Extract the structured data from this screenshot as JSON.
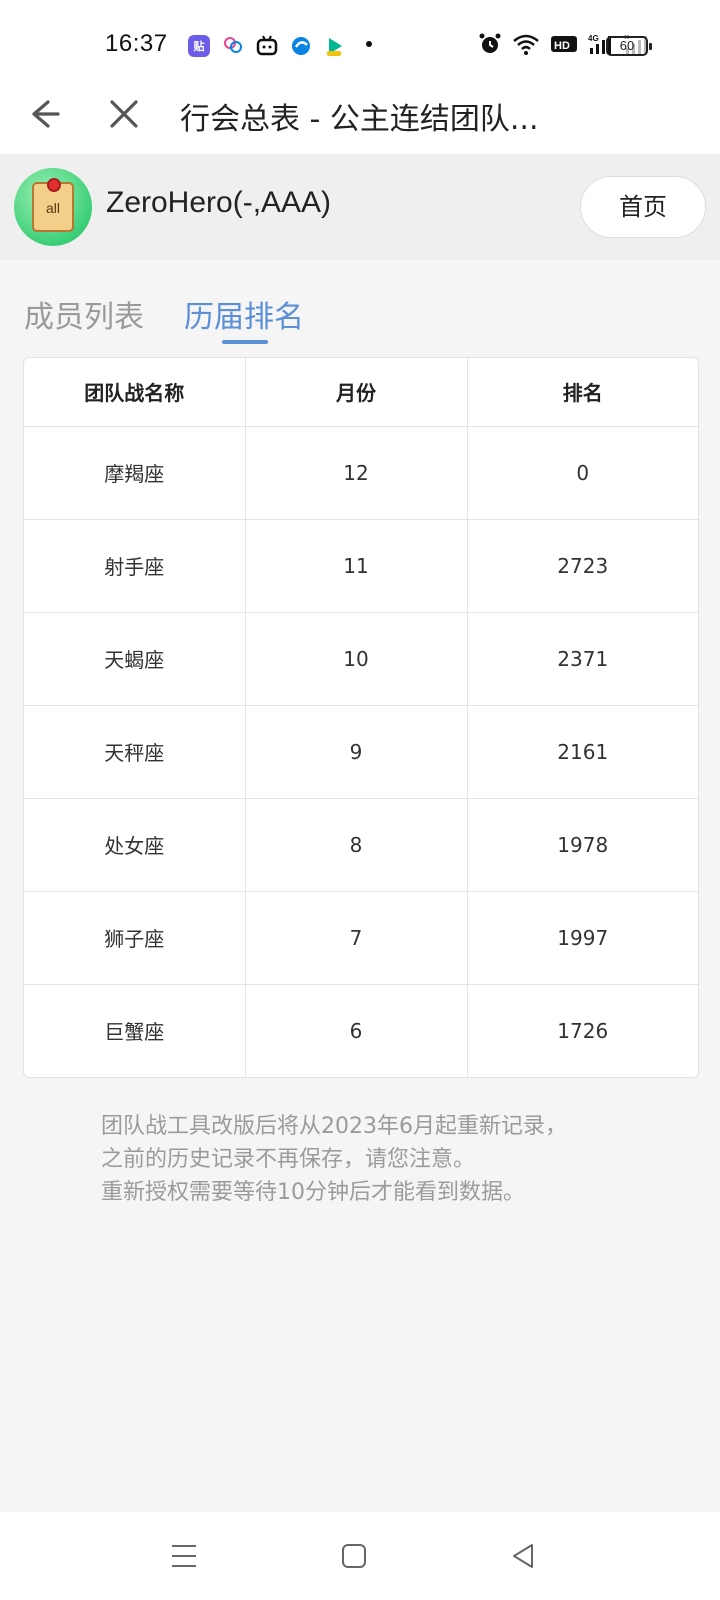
{
  "status_bar": {
    "time": "16:37",
    "app_icons": [
      {
        "name": "tieba-icon",
        "label": "贴",
        "color": "#6c5ce7"
      },
      {
        "name": "lines-icon",
        "label": "",
        "color": "#e84393"
      },
      {
        "name": "bilibili-icon",
        "label": "",
        "color": "#111111"
      },
      {
        "name": "browser-icon",
        "label": "",
        "color": "#0984e3"
      },
      {
        "name": "video-icon",
        "label": "",
        "color": "#00b894"
      }
    ],
    "battery": "60"
  },
  "nav": {
    "title": "行会总表 - 公主连结团队..."
  },
  "guild": {
    "avatar_text": "all",
    "name": "ZeroHero(-,AAA)",
    "home_label": "首页"
  },
  "tabs": [
    {
      "label": "成员列表",
      "active": false
    },
    {
      "label": "历届排名",
      "active": true
    }
  ],
  "table": {
    "headers": [
      "团队战名称",
      "月份",
      "排名"
    ],
    "rows": [
      {
        "name": "摩羯座",
        "month": "12",
        "rank": "0"
      },
      {
        "name": "射手座",
        "month": "11",
        "rank": "2723"
      },
      {
        "name": "天蝎座",
        "month": "10",
        "rank": "2371"
      },
      {
        "name": "天秤座",
        "month": "9",
        "rank": "2161"
      },
      {
        "name": "处女座",
        "month": "8",
        "rank": "1978"
      },
      {
        "name": "狮子座",
        "month": "7",
        "rank": "1997"
      },
      {
        "name": "巨蟹座",
        "month": "6",
        "rank": "1726"
      }
    ]
  },
  "note": {
    "lines": [
      "团队战工具改版后将从2023年6月起重新记录，",
      "之前的历史记录不再保存，请您注意。",
      "重新授权需要等待10分钟后才能看到数据。"
    ]
  },
  "colors": {
    "accent": "#5b8fd6",
    "muted_text": "#9b9b9b"
  }
}
